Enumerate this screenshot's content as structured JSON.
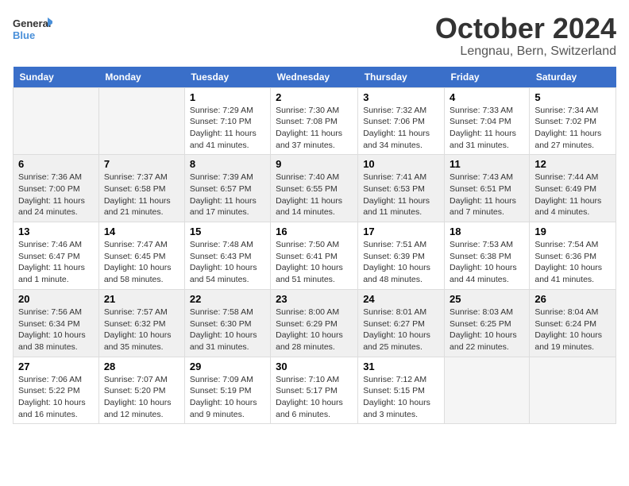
{
  "logo": {
    "line1": "General",
    "line2": "Blue"
  },
  "title": "October 2024",
  "location": "Lengnau, Bern, Switzerland",
  "days_header": [
    "Sunday",
    "Monday",
    "Tuesday",
    "Wednesday",
    "Thursday",
    "Friday",
    "Saturday"
  ],
  "weeks": [
    [
      {
        "day": "",
        "sunrise": "",
        "sunset": "",
        "daylight": ""
      },
      {
        "day": "",
        "sunrise": "",
        "sunset": "",
        "daylight": ""
      },
      {
        "day": "1",
        "sunrise": "Sunrise: 7:29 AM",
        "sunset": "Sunset: 7:10 PM",
        "daylight": "Daylight: 11 hours and 41 minutes."
      },
      {
        "day": "2",
        "sunrise": "Sunrise: 7:30 AM",
        "sunset": "Sunset: 7:08 PM",
        "daylight": "Daylight: 11 hours and 37 minutes."
      },
      {
        "day": "3",
        "sunrise": "Sunrise: 7:32 AM",
        "sunset": "Sunset: 7:06 PM",
        "daylight": "Daylight: 11 hours and 34 minutes."
      },
      {
        "day": "4",
        "sunrise": "Sunrise: 7:33 AM",
        "sunset": "Sunset: 7:04 PM",
        "daylight": "Daylight: 11 hours and 31 minutes."
      },
      {
        "day": "5",
        "sunrise": "Sunrise: 7:34 AM",
        "sunset": "Sunset: 7:02 PM",
        "daylight": "Daylight: 11 hours and 27 minutes."
      }
    ],
    [
      {
        "day": "6",
        "sunrise": "Sunrise: 7:36 AM",
        "sunset": "Sunset: 7:00 PM",
        "daylight": "Daylight: 11 hours and 24 minutes."
      },
      {
        "day": "7",
        "sunrise": "Sunrise: 7:37 AM",
        "sunset": "Sunset: 6:58 PM",
        "daylight": "Daylight: 11 hours and 21 minutes."
      },
      {
        "day": "8",
        "sunrise": "Sunrise: 7:39 AM",
        "sunset": "Sunset: 6:57 PM",
        "daylight": "Daylight: 11 hours and 17 minutes."
      },
      {
        "day": "9",
        "sunrise": "Sunrise: 7:40 AM",
        "sunset": "Sunset: 6:55 PM",
        "daylight": "Daylight: 11 hours and 14 minutes."
      },
      {
        "day": "10",
        "sunrise": "Sunrise: 7:41 AM",
        "sunset": "Sunset: 6:53 PM",
        "daylight": "Daylight: 11 hours and 11 minutes."
      },
      {
        "day": "11",
        "sunrise": "Sunrise: 7:43 AM",
        "sunset": "Sunset: 6:51 PM",
        "daylight": "Daylight: 11 hours and 7 minutes."
      },
      {
        "day": "12",
        "sunrise": "Sunrise: 7:44 AM",
        "sunset": "Sunset: 6:49 PM",
        "daylight": "Daylight: 11 hours and 4 minutes."
      }
    ],
    [
      {
        "day": "13",
        "sunrise": "Sunrise: 7:46 AM",
        "sunset": "Sunset: 6:47 PM",
        "daylight": "Daylight: 11 hours and 1 minute."
      },
      {
        "day": "14",
        "sunrise": "Sunrise: 7:47 AM",
        "sunset": "Sunset: 6:45 PM",
        "daylight": "Daylight: 10 hours and 58 minutes."
      },
      {
        "day": "15",
        "sunrise": "Sunrise: 7:48 AM",
        "sunset": "Sunset: 6:43 PM",
        "daylight": "Daylight: 10 hours and 54 minutes."
      },
      {
        "day": "16",
        "sunrise": "Sunrise: 7:50 AM",
        "sunset": "Sunset: 6:41 PM",
        "daylight": "Daylight: 10 hours and 51 minutes."
      },
      {
        "day": "17",
        "sunrise": "Sunrise: 7:51 AM",
        "sunset": "Sunset: 6:39 PM",
        "daylight": "Daylight: 10 hours and 48 minutes."
      },
      {
        "day": "18",
        "sunrise": "Sunrise: 7:53 AM",
        "sunset": "Sunset: 6:38 PM",
        "daylight": "Daylight: 10 hours and 44 minutes."
      },
      {
        "day": "19",
        "sunrise": "Sunrise: 7:54 AM",
        "sunset": "Sunset: 6:36 PM",
        "daylight": "Daylight: 10 hours and 41 minutes."
      }
    ],
    [
      {
        "day": "20",
        "sunrise": "Sunrise: 7:56 AM",
        "sunset": "Sunset: 6:34 PM",
        "daylight": "Daylight: 10 hours and 38 minutes."
      },
      {
        "day": "21",
        "sunrise": "Sunrise: 7:57 AM",
        "sunset": "Sunset: 6:32 PM",
        "daylight": "Daylight: 10 hours and 35 minutes."
      },
      {
        "day": "22",
        "sunrise": "Sunrise: 7:58 AM",
        "sunset": "Sunset: 6:30 PM",
        "daylight": "Daylight: 10 hours and 31 minutes."
      },
      {
        "day": "23",
        "sunrise": "Sunrise: 8:00 AM",
        "sunset": "Sunset: 6:29 PM",
        "daylight": "Daylight: 10 hours and 28 minutes."
      },
      {
        "day": "24",
        "sunrise": "Sunrise: 8:01 AM",
        "sunset": "Sunset: 6:27 PM",
        "daylight": "Daylight: 10 hours and 25 minutes."
      },
      {
        "day": "25",
        "sunrise": "Sunrise: 8:03 AM",
        "sunset": "Sunset: 6:25 PM",
        "daylight": "Daylight: 10 hours and 22 minutes."
      },
      {
        "day": "26",
        "sunrise": "Sunrise: 8:04 AM",
        "sunset": "Sunset: 6:24 PM",
        "daylight": "Daylight: 10 hours and 19 minutes."
      }
    ],
    [
      {
        "day": "27",
        "sunrise": "Sunrise: 7:06 AM",
        "sunset": "Sunset: 5:22 PM",
        "daylight": "Daylight: 10 hours and 16 minutes."
      },
      {
        "day": "28",
        "sunrise": "Sunrise: 7:07 AM",
        "sunset": "Sunset: 5:20 PM",
        "daylight": "Daylight: 10 hours and 12 minutes."
      },
      {
        "day": "29",
        "sunrise": "Sunrise: 7:09 AM",
        "sunset": "Sunset: 5:19 PM",
        "daylight": "Daylight: 10 hours and 9 minutes."
      },
      {
        "day": "30",
        "sunrise": "Sunrise: 7:10 AM",
        "sunset": "Sunset: 5:17 PM",
        "daylight": "Daylight: 10 hours and 6 minutes."
      },
      {
        "day": "31",
        "sunrise": "Sunrise: 7:12 AM",
        "sunset": "Sunset: 5:15 PM",
        "daylight": "Daylight: 10 hours and 3 minutes."
      },
      {
        "day": "",
        "sunrise": "",
        "sunset": "",
        "daylight": ""
      },
      {
        "day": "",
        "sunrise": "",
        "sunset": "",
        "daylight": ""
      }
    ]
  ]
}
